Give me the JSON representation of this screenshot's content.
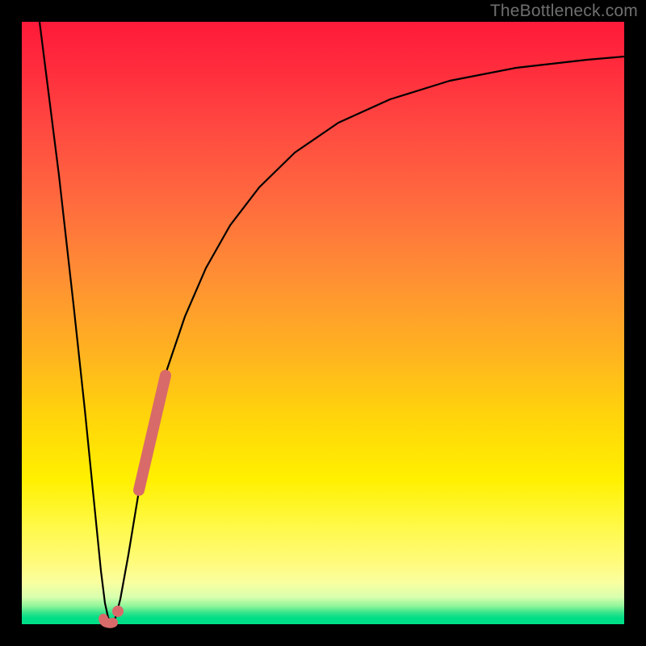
{
  "watermark": "TheBottleneck.com",
  "chart_data": {
    "type": "line",
    "title": "",
    "xlabel": "",
    "ylabel": "",
    "xlim": [
      0,
      100
    ],
    "ylim": [
      0,
      100
    ],
    "grid": false,
    "series": [
      {
        "name": "bottleneck-curve",
        "x": [
          3,
          6,
          8,
          10,
          12,
          13,
          14,
          15,
          16,
          18,
          20,
          22,
          24,
          27,
          30,
          34,
          38,
          44,
          52,
          62,
          74,
          88,
          100
        ],
        "y": [
          100,
          70,
          42,
          20,
          6,
          1,
          0,
          1,
          6,
          16,
          27,
          36,
          44,
          53,
          60,
          67,
          73,
          79,
          84,
          88,
          91,
          93,
          94
        ]
      }
    ],
    "highlight_segments": [
      {
        "name": "rising-steep-segment",
        "x": [
          19,
          23.5
        ],
        "y": [
          24,
          42
        ]
      }
    ],
    "highlight_points": [
      {
        "name": "valley-hook",
        "x": 13.2,
        "y": 0.5
      },
      {
        "name": "valley-hook-2",
        "x": 14.4,
        "y": 0.2
      }
    ],
    "colors": {
      "curve": "#000000",
      "highlight": "#d96a6a",
      "gradient_top": "#ff1a3a",
      "gradient_mid": "#ffd60a",
      "gradient_bottom": "#00e088"
    }
  }
}
